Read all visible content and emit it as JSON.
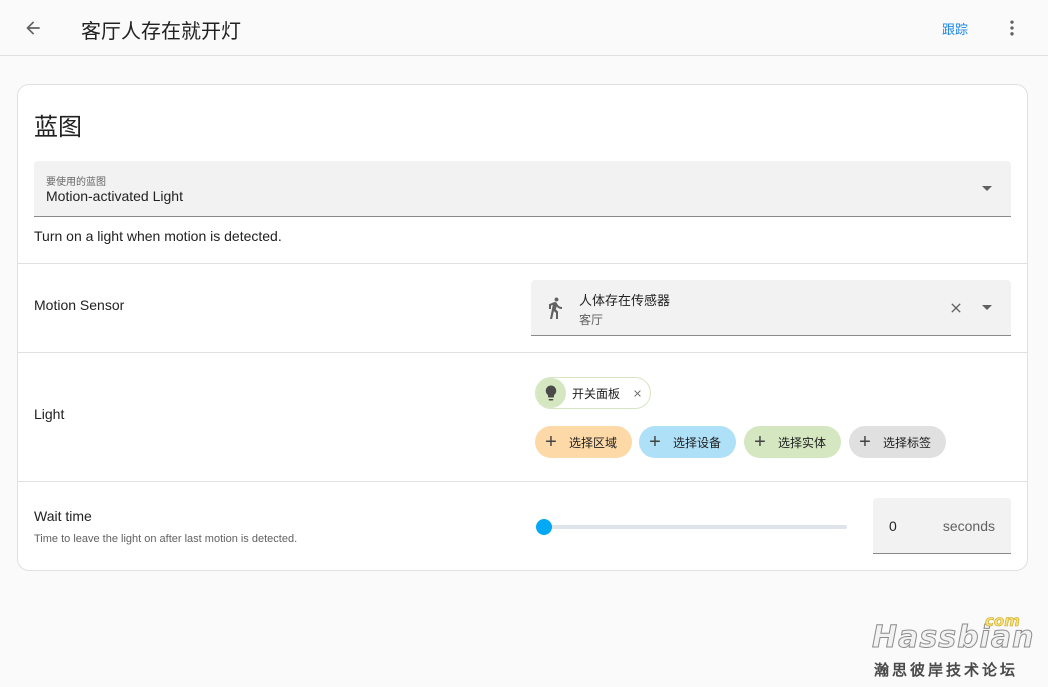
{
  "header": {
    "title": "客厅人存在就开灯",
    "trace_label": "跟踪"
  },
  "blueprint": {
    "section_title": "蓝图",
    "select_label": "要使用的蓝图",
    "select_value": "Motion-activated Light",
    "description": "Turn on a light when motion is detected."
  },
  "motion_sensor": {
    "label": "Motion Sensor",
    "entity_name": "人体存在传感器",
    "entity_area": "客厅",
    "icon": "motion-sensor-icon"
  },
  "light": {
    "label": "Light",
    "selected_entity": "开关面板",
    "selected_icon": "lightbulb-icon",
    "add_chips": [
      {
        "label": "选择区域",
        "color": "#fdd9a8"
      },
      {
        "label": "选择设备",
        "color": "#aee0f7"
      },
      {
        "label": "选择实体",
        "color": "#d4e7c1"
      },
      {
        "label": "选择标签",
        "color": "#e0e0e0"
      }
    ]
  },
  "wait_time": {
    "label": "Wait time",
    "description": "Time to leave the light on after last motion is detected.",
    "value": "0",
    "unit": "seconds",
    "slider_fraction": 0
  },
  "colors": {
    "accent": "#03a9f4",
    "link": "#1e88e5"
  },
  "watermark": {
    "brand": "Hassbian",
    "tld": "com",
    "subtitle": "瀚思彼岸技术论坛"
  }
}
